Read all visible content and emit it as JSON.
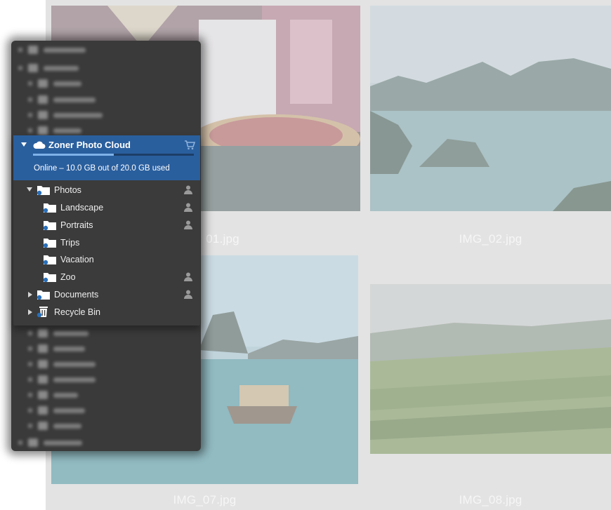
{
  "gallery": {
    "thumbnails": [
      {
        "caption": "IMG_01.jpg",
        "visible_caption": "01.jpg"
      },
      {
        "caption": "IMG_02.jpg"
      },
      {
        "caption": "IMG_07.jpg"
      },
      {
        "caption": "IMG_08.jpg"
      }
    ]
  },
  "cloud": {
    "title": "Zoner Photo Cloud",
    "status": "Online – 10.0 GB out of 20.0 GB used",
    "storage_used_fraction": 0.5,
    "accent_color": "#2a5f9e"
  },
  "tree": [
    {
      "label": "Photos",
      "icon": "cloud-folder-icon",
      "expanded": true,
      "shared": true
    },
    {
      "label": "Landscape",
      "icon": "cloud-folder-icon",
      "shared": true
    },
    {
      "label": "Portraits",
      "icon": "cloud-folder-icon",
      "shared": true
    },
    {
      "label": "Trips",
      "icon": "cloud-folder-icon",
      "shared": false
    },
    {
      "label": "Vacation",
      "icon": "cloud-folder-icon",
      "shared": false
    },
    {
      "label": "Zoo",
      "icon": "cloud-folder-icon",
      "shared": true
    },
    {
      "label": "Documents",
      "icon": "cloud-folder-icon",
      "expanded": false,
      "shared": true
    },
    {
      "label": "Recycle Bin",
      "icon": "recycle-bin-icon",
      "expanded": false,
      "shared": false
    }
  ]
}
